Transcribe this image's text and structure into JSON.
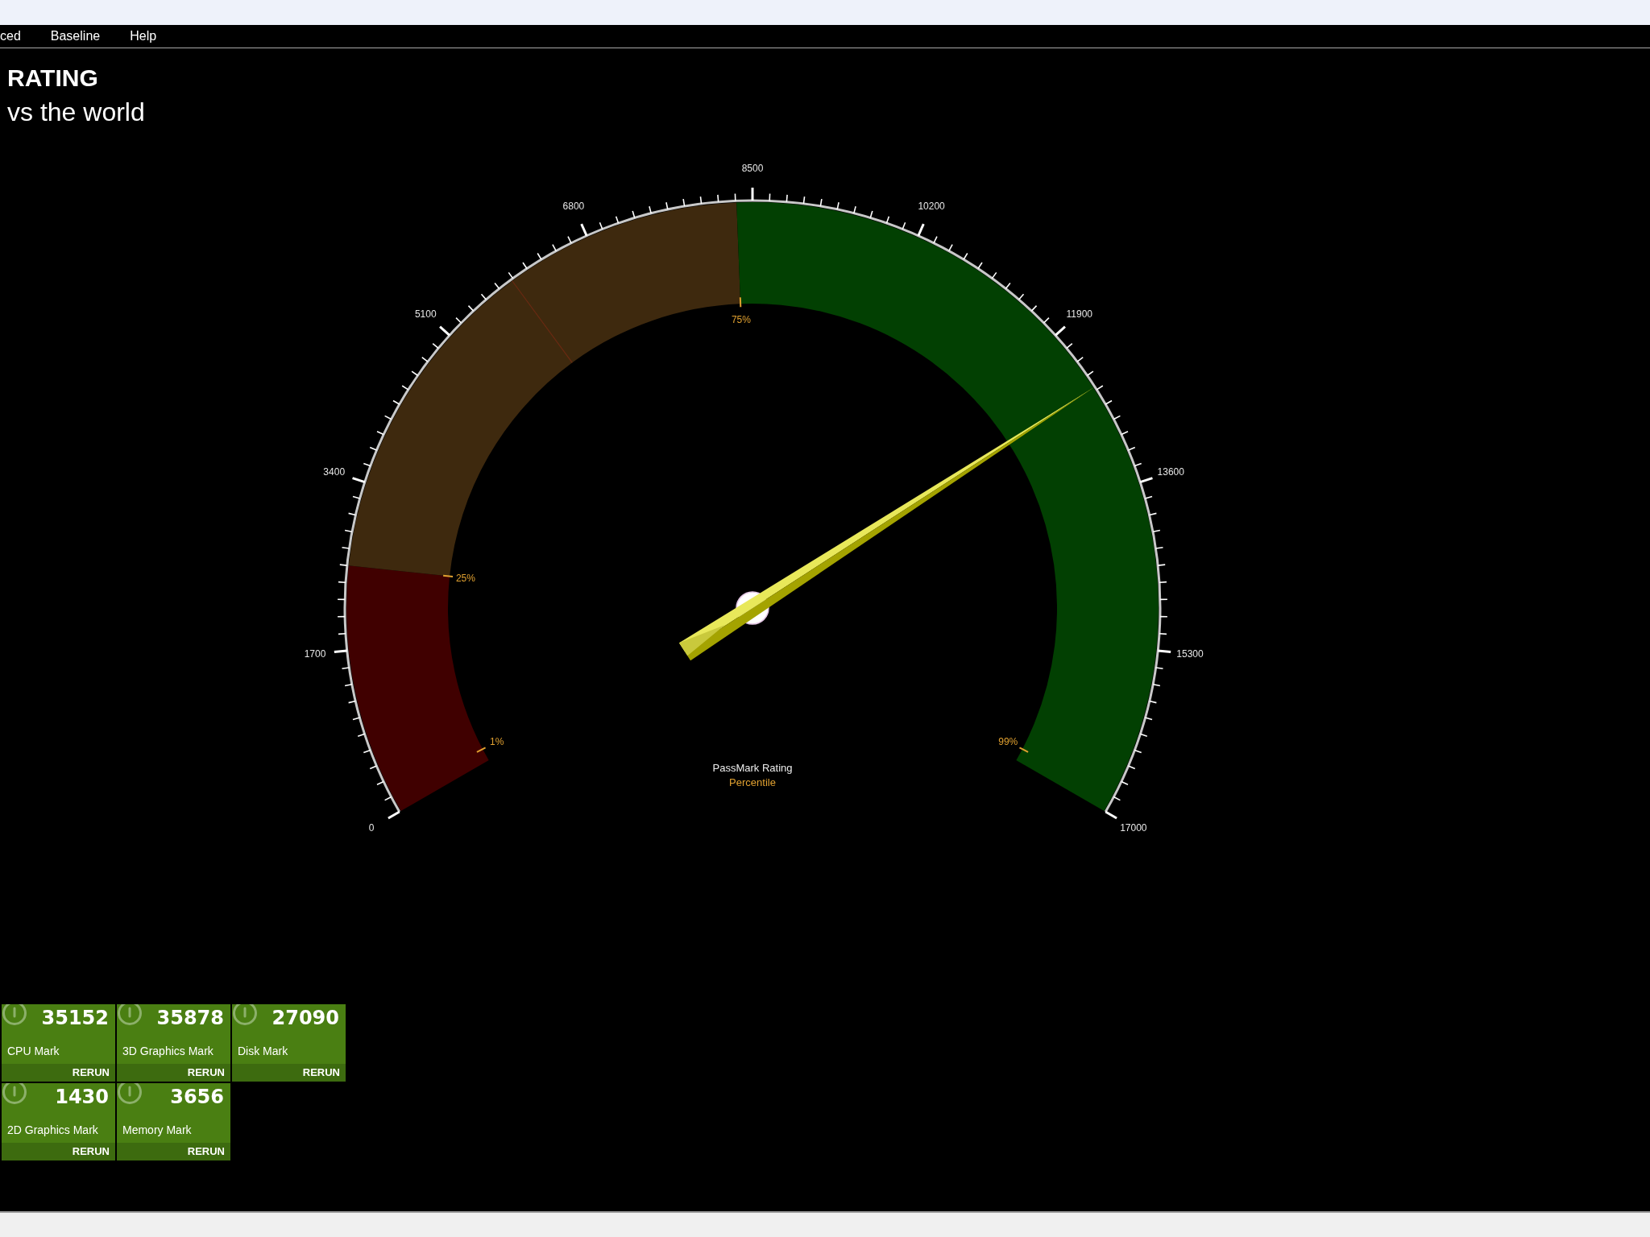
{
  "menu": [
    {
      "label": "ced"
    },
    {
      "label": "Baseline"
    },
    {
      "label": "Help"
    }
  ],
  "heading": {
    "title": "RATING",
    "subtitle": "vs the world"
  },
  "gauge": {
    "scale_labels": [
      "0",
      "1700",
      "3400",
      "5100",
      "6800",
      "8500",
      "10200",
      "11900",
      "13600",
      "15300",
      "17000"
    ],
    "percentile_marks": [
      {
        "label": "1%"
      },
      {
        "label": "25%"
      },
      {
        "label": "75%"
      },
      {
        "label": "99%"
      }
    ],
    "level": 0.738,
    "chart_data": [
      {
        "type": "donut",
        "title": "PassMark Rating",
        "subtitle": "Percentile",
        "values": [
          15,
          19.88,
          14.18,
          50.94
        ],
        "colors": [
          "#400000",
          "#3e290e",
          "#3e290e",
          "#024002"
        ]
      }
    ]
  },
  "tiles": [
    {
      "value": "35152",
      "label": "CPU Mark",
      "action": "RERUN"
    },
    {
      "value": "35878",
      "label": "3D Graphics Mark",
      "action": "RERUN"
    },
    {
      "value": "27090",
      "label": "Disk Mark",
      "action": "RERUN"
    },
    {
      "value": "1430",
      "label": "2D Graphics Mark",
      "action": "RERUN"
    },
    {
      "value": "3656",
      "label": "Memory Mark",
      "action": "RERUN"
    }
  ]
}
